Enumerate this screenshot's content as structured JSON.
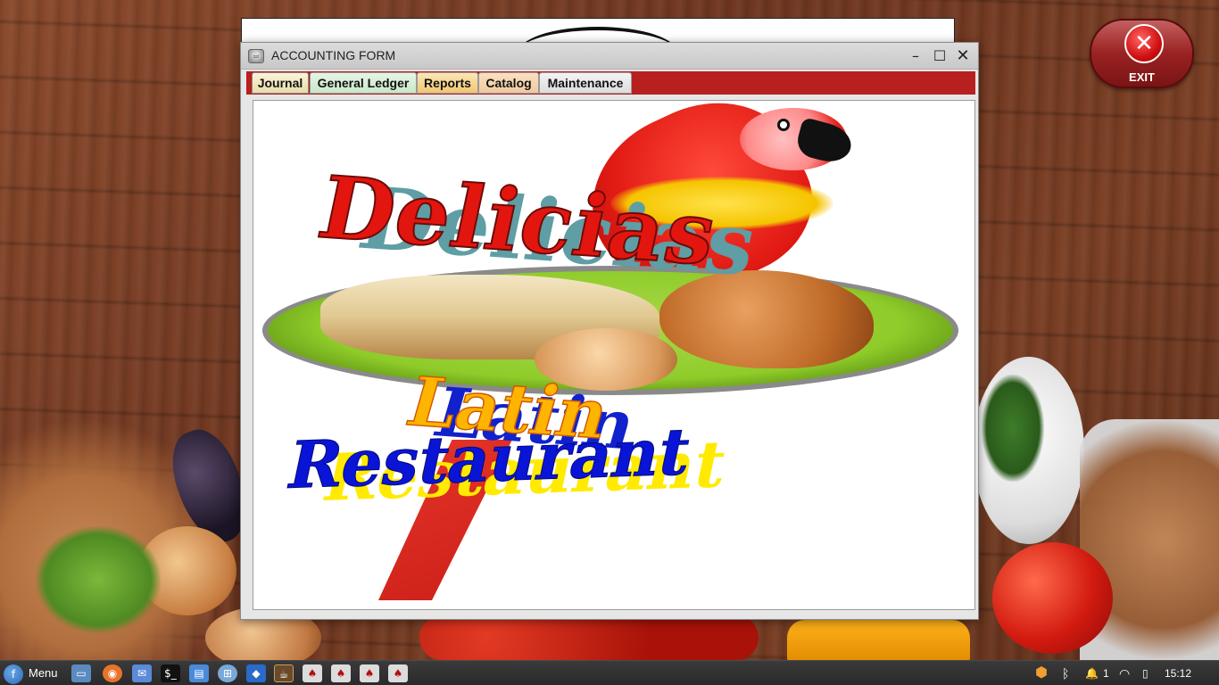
{
  "desktop": {
    "exit_button": {
      "label": "EXIT",
      "icon": "close-x-icon"
    }
  },
  "window": {
    "title": "ACCOUNTING FORM",
    "app_icon": "coffee-cup-icon",
    "controls": {
      "minimize": "–",
      "maximize": "☐",
      "close": "✕"
    },
    "tabs": [
      {
        "label": "Journal"
      },
      {
        "label": "General Ledger"
      },
      {
        "label": "Reports"
      },
      {
        "label": "Catalog"
      },
      {
        "label": "Maintenance"
      }
    ],
    "logo": {
      "line1": "Delicias",
      "line2": "Latin",
      "line3": "Restaurant"
    }
  },
  "taskbar": {
    "menu_label": "Menu",
    "apps": [
      "show-desktop-icon",
      "firefox-icon",
      "mail-icon",
      "terminal-icon",
      "files-icon",
      "app-grid-icon",
      "vscode-icon",
      "java-app-icon",
      "window-icon-1",
      "window-icon-2",
      "window-icon-3",
      "window-icon-4"
    ],
    "tray": {
      "notifications_count": "1",
      "clock": "15:12"
    }
  },
  "colors": {
    "tab_bar": "#b81f1f",
    "exit_button": "#9a2222",
    "taskbar": "#2a2a2a"
  }
}
